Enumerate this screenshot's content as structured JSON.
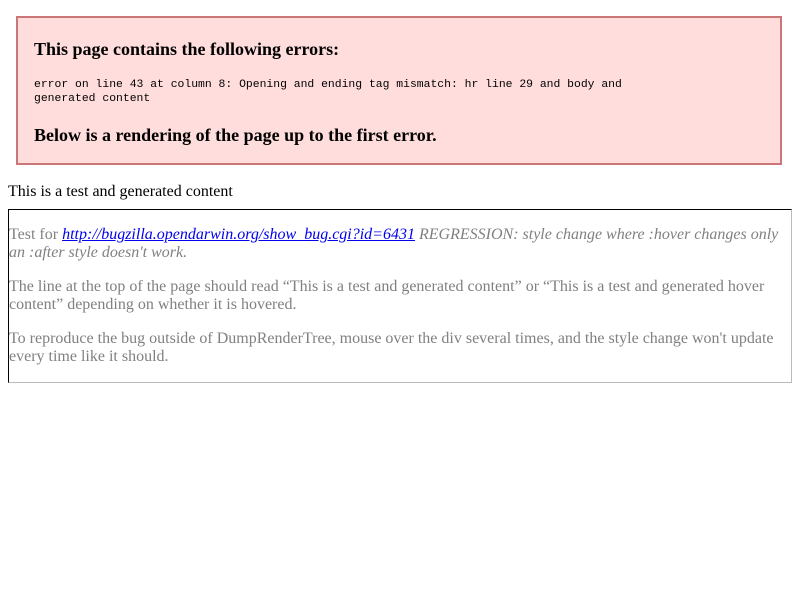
{
  "error_box": {
    "heading": "This page contains the following errors:",
    "detail": "error on line 43 at column 8: Opening and ending tag mismatch: hr line 29 and body and generated content",
    "footer": "Below is a rendering of the page up to the first error."
  },
  "generated_line": "This is a test and generated content",
  "content": {
    "p1_prefix": "Test for ",
    "p1_link": "http://bugzilla.opendarwin.org/show_bug.cgi?id=6431",
    "p1_suffix": " REGRESSION: style change where :hover changes only an :after style doesn't work.",
    "p2": "The line at the top of the page should read “This is a test and generated content” or “This is a test and generated hover content” depending on whether it is hovered.",
    "p3": "To reproduce the bug outside of DumpRenderTree, mouse over the div several times, and the style change won't update every time like it should."
  },
  "colors": {
    "error_background": "#ffdddd",
    "error_border": "#cc7777",
    "link": "#0000ee",
    "body_text": "#808080"
  }
}
